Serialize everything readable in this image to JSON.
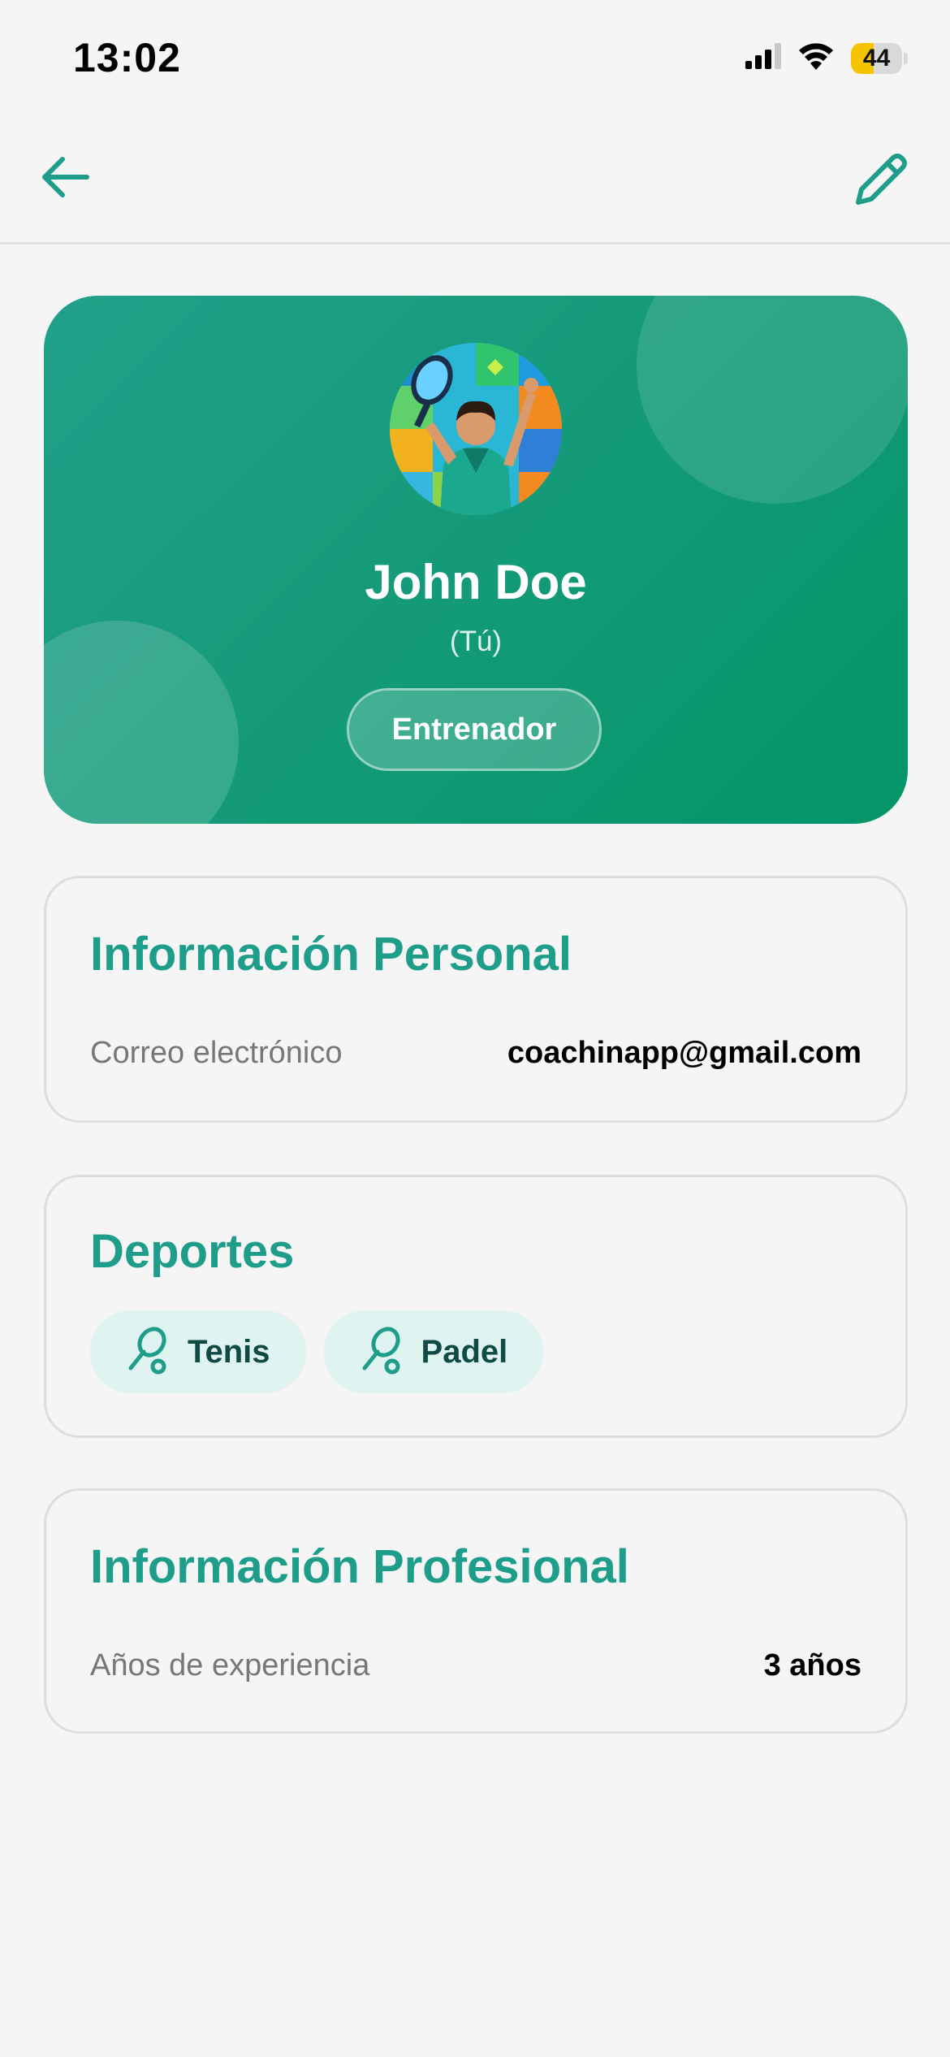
{
  "status_bar": {
    "time": "13:02",
    "battery": 44,
    "battery_color": "#f5c400",
    "icons": [
      "cellular-signal-icon",
      "wifi-icon",
      "battery-icon"
    ]
  },
  "nav": {
    "back_icon": "arrow-left-icon",
    "edit_icon": "pencil-icon",
    "accent_color": "#1e9e8a"
  },
  "profile": {
    "name": "John Doe",
    "self_tag": "(Tú)",
    "role": "Entrenador",
    "avatar_icon": "padel-player-avatar",
    "card_gradient": [
      "#22a08a",
      "#039668"
    ]
  },
  "personal_info": {
    "title": "Información Personal",
    "email_label": "Correo electrónico",
    "email_value": "coachinapp@gmail.com"
  },
  "sports": {
    "title": "Deportes",
    "items": [
      {
        "label": "Tenis",
        "icon": "racket-icon"
      },
      {
        "label": "Padel",
        "icon": "racket-icon"
      }
    ]
  },
  "professional_info": {
    "title": "Información Profesional",
    "experience_label": "Años de experiencia",
    "experience_value": "3 años"
  }
}
